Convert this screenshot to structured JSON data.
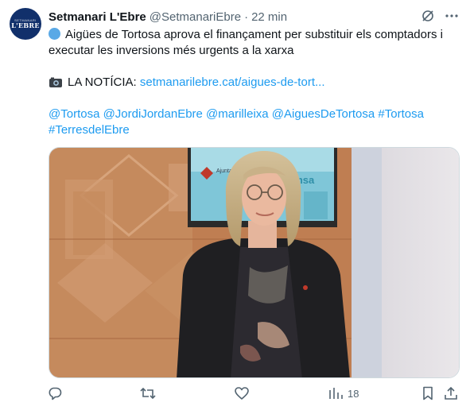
{
  "account": {
    "avatar_text_small": "SETMANARI",
    "avatar_text_big": "L'EBRE",
    "name": "Setmanari L'Ebre",
    "handle": "@SetmanariEbre",
    "separator": "·",
    "time": "22 min"
  },
  "post": {
    "headline_line1": "Aigües de Tortosa aprova el finançament per substituir els comptadors i",
    "headline_line2": "executar les inversions més urgents a la xarxa",
    "news_label": "LA NOTÍCIA:",
    "news_link": "setmanarilebre.cat/aigues-de-tort...",
    "mentions_line1": "@Tortosa @JordiJordanEbre @marilleixa @AiguesDeTortosa #Tortosa",
    "mentions_line2": "#TerresdelEbre"
  },
  "media": {
    "screen_brand": "Ajuntament de Tortosa",
    "screen_text": "emsa"
  },
  "actions": {
    "views_count": "18"
  },
  "colors": {
    "accent": "#1d9bf0",
    "text": "#0f1419",
    "muted": "#536471",
    "avatar_bg": "#11306b"
  }
}
